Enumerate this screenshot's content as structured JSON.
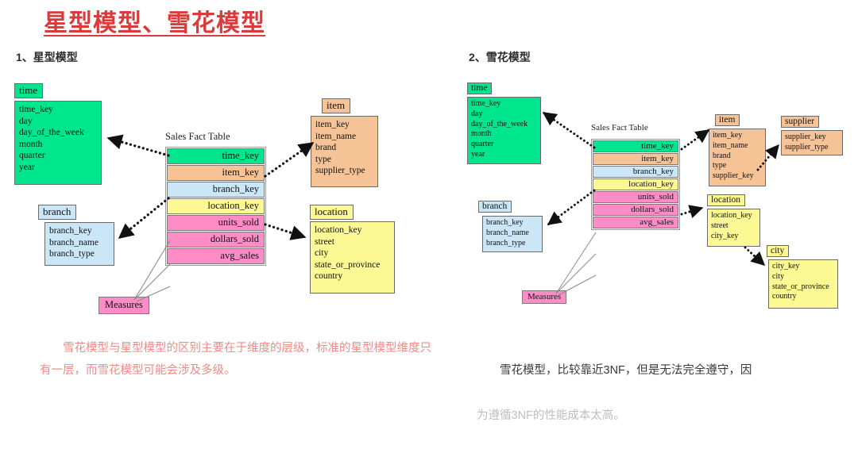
{
  "title": "星型模型、雪花模型",
  "sections": {
    "star": {
      "heading": "1、星型模型"
    },
    "snowflake": {
      "heading": "2、雪花模型"
    }
  },
  "star_diagram": {
    "fact_label": "Sales Fact Table",
    "fact_rows": [
      {
        "label": "time_key",
        "color": "#00e68e"
      },
      {
        "label": "item_key",
        "color": "#f6c396"
      },
      {
        "label": "branch_key",
        "color": "#cbe6f7"
      },
      {
        "label": "location_key",
        "color": "#fcf894"
      },
      {
        "label": "units_sold",
        "color": "#ff8cc6"
      },
      {
        "label": "dollars_sold",
        "color": "#ff8cc6"
      },
      {
        "label": "avg_sales",
        "color": "#ff8cc6"
      }
    ],
    "measures_label": "Measures",
    "time": {
      "name": "time",
      "color": "#00e68e",
      "fields": [
        "time_key",
        "day",
        "day_of_the_week",
        "month",
        "quarter",
        "year"
      ]
    },
    "branch": {
      "name": "branch",
      "color": "#cbe6f7",
      "fields": [
        "branch_key",
        "branch_name",
        "branch_type"
      ]
    },
    "item": {
      "name": "item",
      "color": "#f6c396",
      "fields": [
        "item_key",
        "item_name",
        "brand",
        "type",
        "supplier_type"
      ]
    },
    "location": {
      "name": "location",
      "color": "#fcf894",
      "fields": [
        "location_key",
        "street",
        "city",
        "state_or_province",
        "country"
      ]
    }
  },
  "snowflake_diagram": {
    "fact_label": "Sales Fact Table",
    "fact_rows": [
      {
        "label": "time_key",
        "color": "#00e68e"
      },
      {
        "label": "item_key",
        "color": "#f6c396"
      },
      {
        "label": "branch_key",
        "color": "#cbe6f7"
      },
      {
        "label": "location_key",
        "color": "#fcf894"
      },
      {
        "label": "units_sold",
        "color": "#ff8cc6"
      },
      {
        "label": "dollars_sold",
        "color": "#ff8cc6"
      },
      {
        "label": "avg_sales",
        "color": "#ff8cc6"
      }
    ],
    "measures_label": "Measures",
    "time": {
      "name": "time",
      "color": "#00e68e",
      "fields": [
        "time_key",
        "day",
        "day_of_the_week",
        "month",
        "quarter",
        "year"
      ]
    },
    "branch": {
      "name": "branch",
      "color": "#cbe6f7",
      "fields": [
        "branch_key",
        "branch_name",
        "branch_type"
      ]
    },
    "item": {
      "name": "item",
      "color": "#f6c396",
      "fields": [
        "item_key",
        "item_name",
        "brand",
        "type",
        "supplier_key"
      ]
    },
    "supplier": {
      "name": "supplier",
      "color": "#f6c396",
      "fields": [
        "supplier_key",
        "supplier_type"
      ]
    },
    "location": {
      "name": "location",
      "color": "#fcf894",
      "fields": [
        "location_key",
        "street",
        "city_key"
      ]
    },
    "city": {
      "name": "city",
      "color": "#fcf894",
      "fields": [
        "city_key",
        "city",
        "state_or_province",
        "country"
      ]
    }
  },
  "captions": {
    "left": "　　雪花模型与星型模型的区别主要在于维度的层级，标准的星型模型维度只有一层，而雪花模型可能会涉及多级。",
    "right_line1": "　　雪花模型，比较靠近3NF，但是无法完全遵守，因",
    "right_line2": "为遵循3NF的性能成本太高。"
  },
  "colors": {
    "title": "#d93b3b",
    "caption_left": "#f08a86",
    "caption_right": "#3a3a3a",
    "green": "#00e68e",
    "orange": "#f6c396",
    "blue": "#cbe6f7",
    "yellow": "#fcf894",
    "pink": "#ff8cc6"
  }
}
